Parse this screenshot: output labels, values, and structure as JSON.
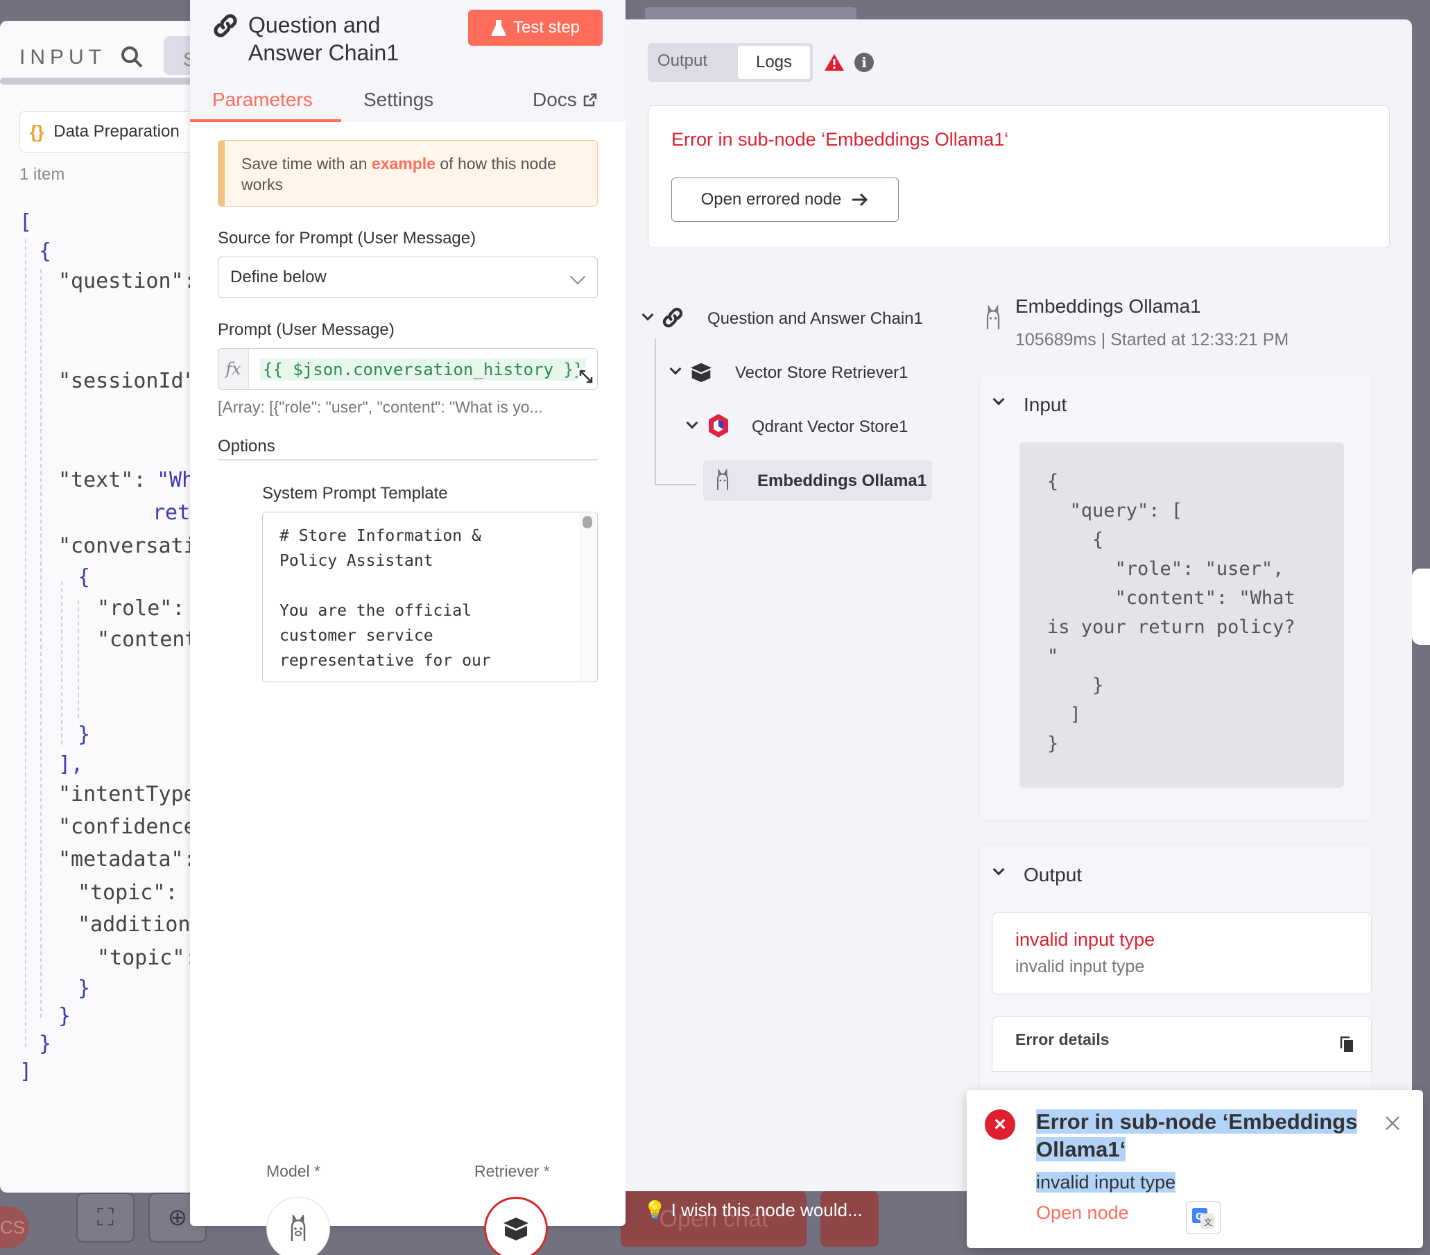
{
  "input_panel": {
    "title": "INPUT",
    "tab_partial": "S",
    "node_name": "Data Preparation",
    "item_count": "1 item",
    "json": {
      "open_bracket": "[",
      "open_brace": "{",
      "question": "\"question\":",
      "session_id": "\"sessionId\"",
      "text_key": "\"text\":",
      "text_val": "\"Wh",
      "text_cont": "ret",
      "conversation": "\"conversati",
      "conv_brace": "{",
      "role": "\"role\":",
      "content": "\"content",
      "conv_close": "}",
      "conv_array_close": "],",
      "intent_type": "\"intentType",
      "confidence": "\"confidence",
      "metadata": "\"metadata\":",
      "topic": "\"topic\":",
      "additional": "\"additiona",
      "topic2": "\"topic\":",
      "close1": "}",
      "close2": "}",
      "close3": "}",
      "close_bracket": "]"
    }
  },
  "params": {
    "node_title": "Question and Answer Chain1",
    "test_step": "Test step",
    "tabs": {
      "parameters": "Parameters",
      "settings": "Settings",
      "docs": "Docs"
    },
    "tip": {
      "pre": "Save time with an ",
      "link": "example",
      "post": " of how this node works"
    },
    "source_label": "Source for Prompt (User Message)",
    "source_value": "Define below",
    "prompt_label": "Prompt (User Message)",
    "prompt_expression": "{{ $json.conversation_history }}",
    "prompt_hint": "[Array: [{\"role\": \"user\", \"content\": \"What is yo...",
    "options_label": "Options",
    "system_prompt_label": "System Prompt Template",
    "system_prompt_text": "# Store Information &\nPolicy Assistant\n\nYou are the official\ncustomer service\nrepresentative for our\n",
    "model_label": "Model *",
    "retriever_label": "Retriever *"
  },
  "logs": {
    "output_tab": "Output",
    "logs_tab": "Logs",
    "error_title": "Error in sub-node ‘Embeddings Ollama1‘",
    "open_errored": "Open errored node",
    "tree": [
      {
        "label": "Question and Answer Chain1"
      },
      {
        "label": "Vector Store Retriever1"
      },
      {
        "label": "Qdrant Vector Store1"
      },
      {
        "label": "Embeddings Ollama1"
      }
    ],
    "detail_title": "Embeddings Ollama1",
    "detail_meta": "105689ms | Started at 12:33:21 PM",
    "input_section": "Input",
    "input_code": "{\n  \"query\": [\n    {\n      \"role\": \"user\",\n      \"content\": \"What\nis your return policy?\n\"\n    }\n  ]\n}",
    "output_section": "Output",
    "output_error_title": "invalid input type",
    "output_error_sub": "invalid input type",
    "error_details": "Error details"
  },
  "toast": {
    "title": "Error in sub-node ‘Embeddings Ollama1‘",
    "subtitle": "invalid input type",
    "link": "Open node"
  },
  "background": {
    "feedback": "I wish this node would...",
    "open_chat": "Open chat",
    "avatar": "CS"
  },
  "colors": {
    "accent": "#ff6d5a",
    "error": "#e02030"
  }
}
